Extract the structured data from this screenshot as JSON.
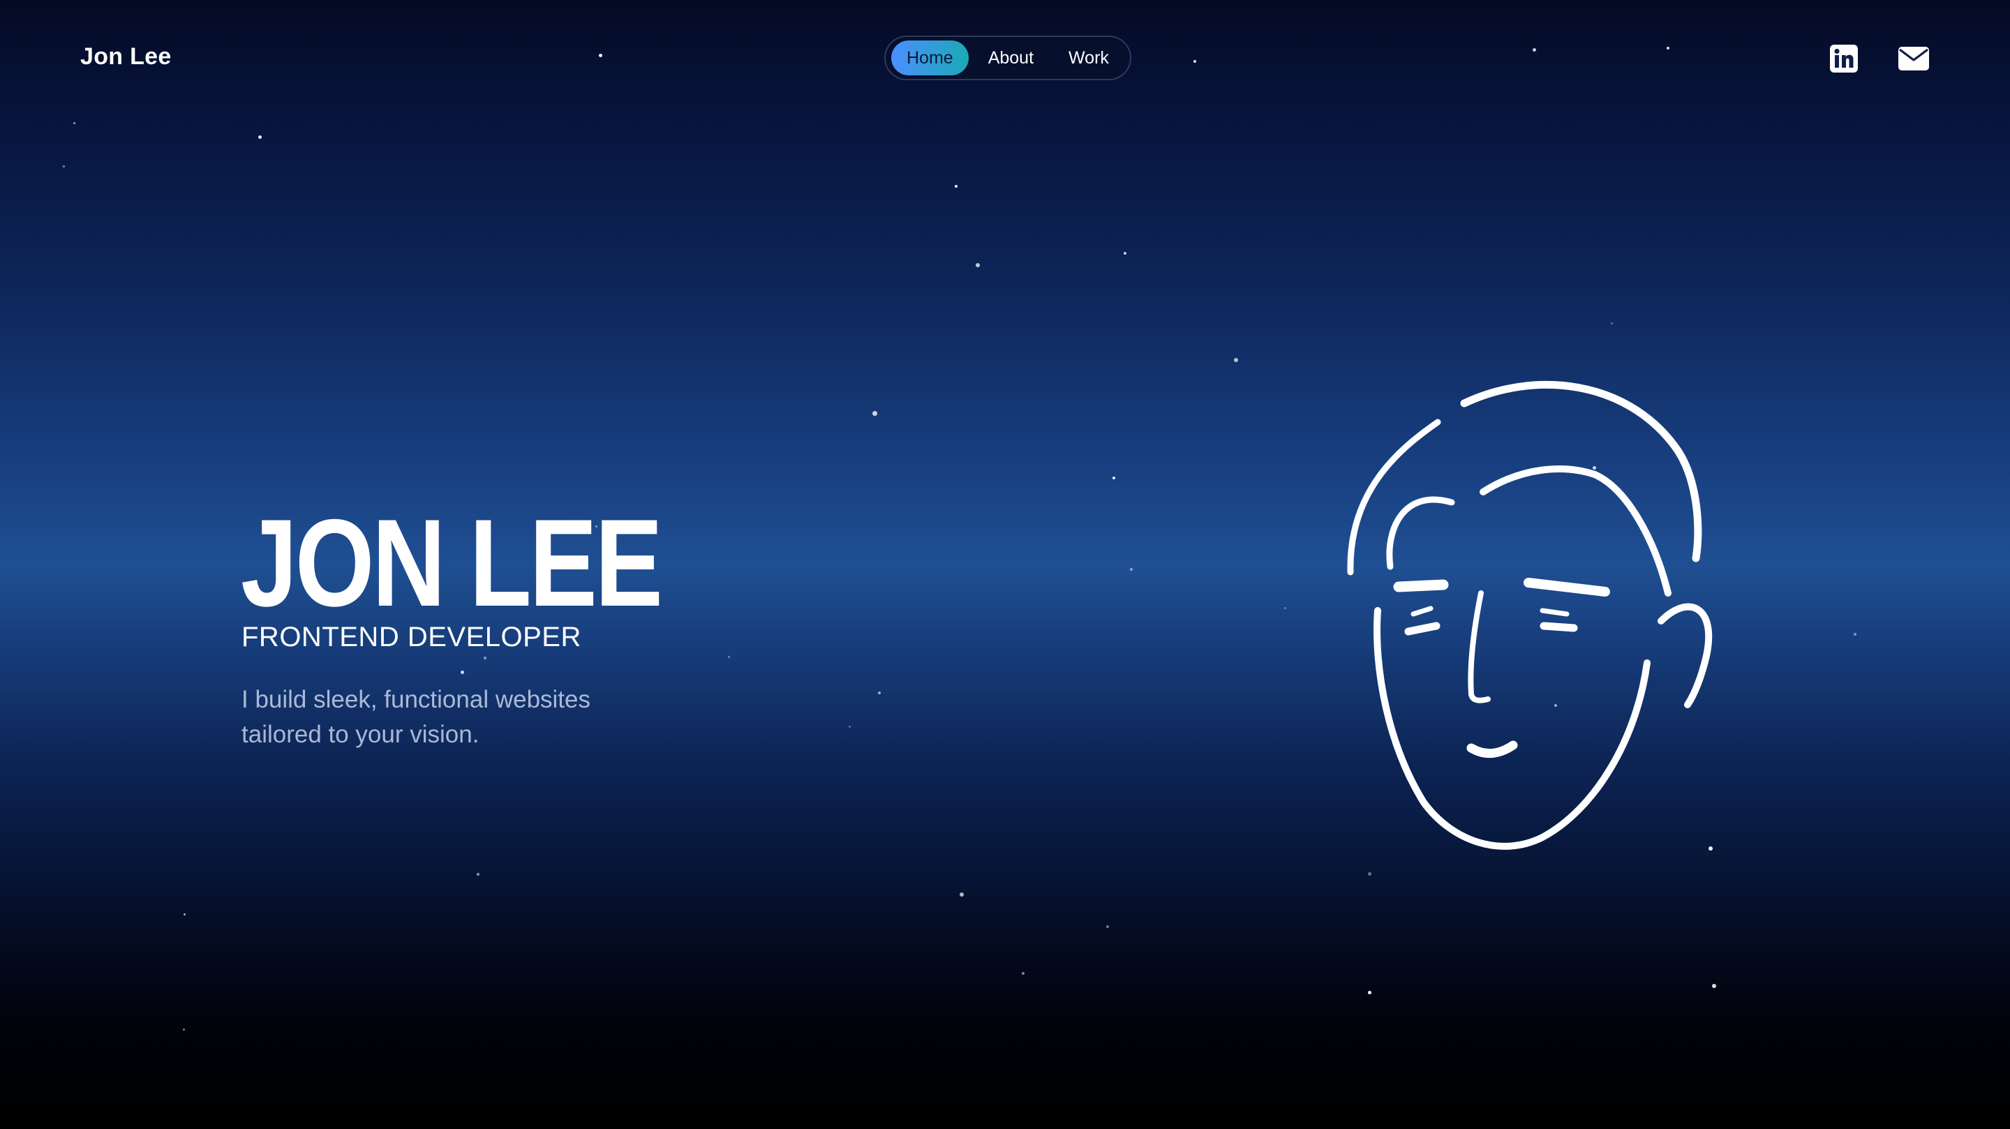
{
  "header": {
    "brand": "Jon Lee",
    "nav": [
      {
        "label": "Home",
        "active": true
      },
      {
        "label": "About",
        "active": false
      },
      {
        "label": "Work",
        "active": false
      }
    ],
    "social": [
      {
        "icon": "linkedin-icon"
      },
      {
        "icon": "mail-icon"
      }
    ]
  },
  "hero": {
    "name": "JON LEE",
    "role": "FRONTEND DEVELOPER",
    "tagline_line1": "I build sleek, functional websites",
    "tagline_line2": "tailored to your vision."
  },
  "illustration": {
    "icon": "face-line-drawing"
  },
  "colors": {
    "background_top": "#050a24",
    "background_mid": "#1f4f93",
    "background_bottom": "#000000",
    "nav_active_start": "#4c8fff",
    "nav_active_end": "#1ba9b5",
    "text": "#ffffff"
  }
}
